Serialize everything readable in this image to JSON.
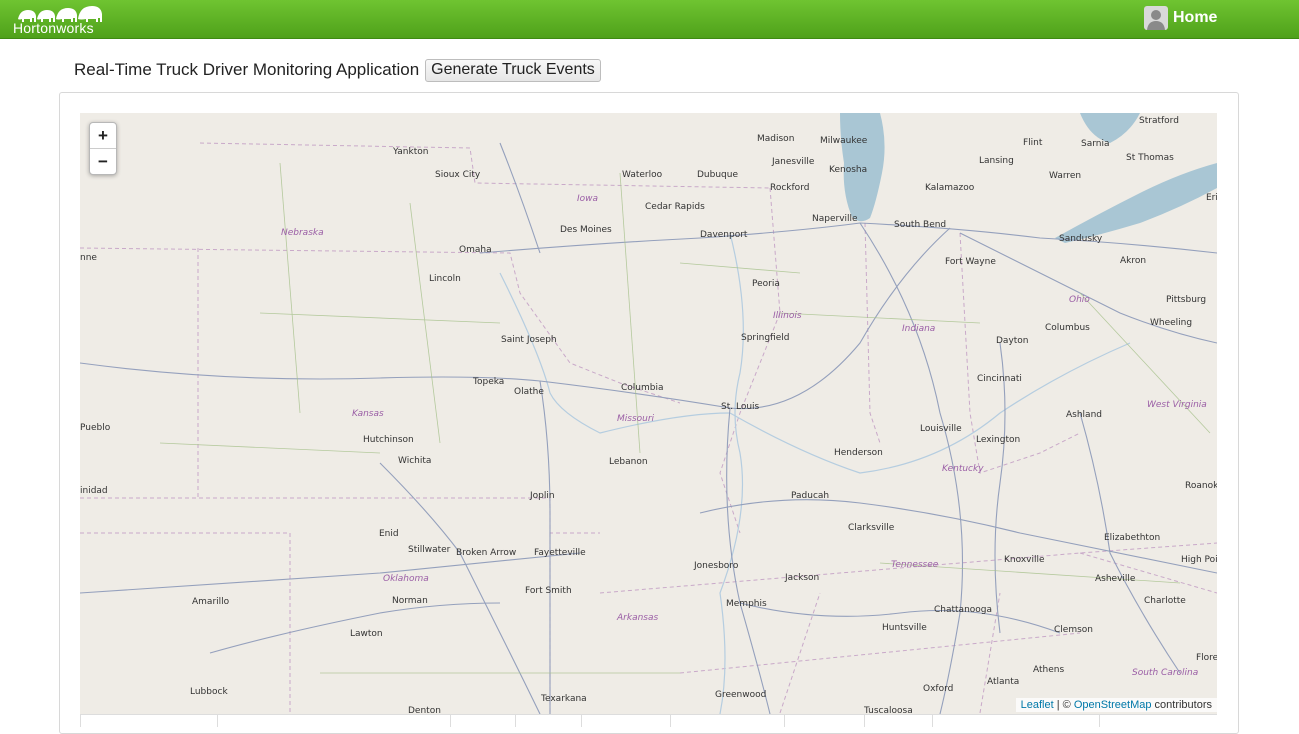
{
  "header": {
    "logo_text": "Hortonworks",
    "home_label": "Home"
  },
  "page": {
    "title": "Real-Time Truck Driver Monitoring Application",
    "generate_button": "Generate Truck Events"
  },
  "map": {
    "zoom_in": "+",
    "zoom_out": "−",
    "attribution": {
      "leaflet": "Leaflet",
      "separator": " | © ",
      "osm": "OpenStreetMap",
      "suffix": " contributors"
    },
    "cities": [
      "Yankton",
      "Sioux City",
      "Madison",
      "Milwaukee",
      "Janesville",
      "Kenosha",
      "Waterloo",
      "Dubuque",
      "Rockford",
      "Cedar Rapids",
      "Des Moines",
      "Davenport",
      "Naperville",
      "South Bend",
      "Flint",
      "Lansing",
      "Kalamazoo",
      "Sarnia",
      "Stratford",
      "St Thomas",
      "Warren",
      "Erie",
      "Sandusky",
      "Akron",
      "Fort Wayne",
      "Omaha",
      "Lincoln",
      "Peoria",
      "Pittsburg",
      "Wheeling",
      "Columbus",
      "Dayton",
      "Springfield",
      "Saint Joseph",
      "Topeka",
      "Olathe",
      "Columbia",
      "St. Louis",
      "Cincinnati",
      "Ashland",
      "Lexington",
      "Louisville",
      "Hutchinson",
      "Wichita",
      "Lebanon",
      "Henderson",
      "Joplin",
      "Paducah",
      "Roanok",
      "Enid",
      "Stillwater",
      "Broken Arrow",
      "Fayetteville",
      "Clarksville",
      "Knoxville",
      "Elizabethton",
      "Jonesboro",
      "Jackson",
      "Asheville",
      "High Poi",
      "Amarillo",
      "Norman",
      "Fort Smith",
      "Memphis",
      "Chattanooga",
      "Charlotte",
      "Lawton",
      "Huntsville",
      "Clemson",
      "Flore",
      "Lubbock",
      "Texarkana",
      "Greenwood",
      "Oxford",
      "Atlanta",
      "Athens",
      "Denton",
      "Tuscaloosa",
      "Pueblo",
      "inidad",
      "nne"
    ],
    "states": [
      "Nebraska",
      "Iowa",
      "Illinois",
      "Indiana",
      "Ohio",
      "Kansas",
      "Missouri",
      "Kentucky",
      "West Virginia",
      "Tennessee",
      "Oklahoma",
      "Arkansas",
      "South Carolina"
    ]
  }
}
